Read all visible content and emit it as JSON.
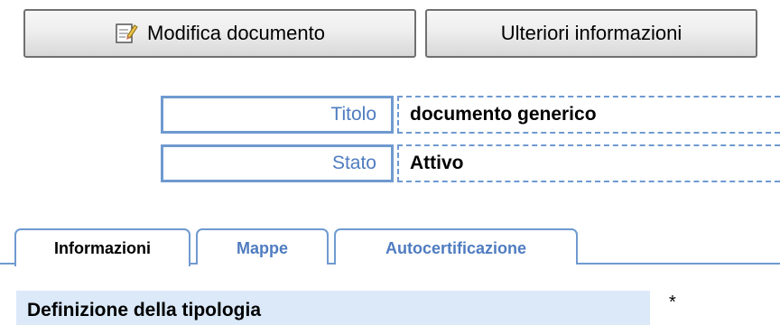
{
  "toolbar": {
    "edit_label": "Modifica documento",
    "info_label": "Ulteriori informazioni"
  },
  "fields": [
    {
      "label": "Titolo",
      "value": "documento generico"
    },
    {
      "label": "Stato",
      "value": "Attivo"
    }
  ],
  "tabs": [
    {
      "label": "Informazioni",
      "active": true
    },
    {
      "label": "Mappe",
      "active": false
    },
    {
      "label": "Autocertificazione",
      "active": false
    }
  ],
  "section": {
    "title": "Definizione della tipologia",
    "required_mark": "*"
  },
  "icons": {
    "edit": "edit-document-icon"
  },
  "colors": {
    "accent": "#6f9ad0",
    "label_text": "#4f7cc0",
    "section_bg": "#dbe9f9"
  }
}
